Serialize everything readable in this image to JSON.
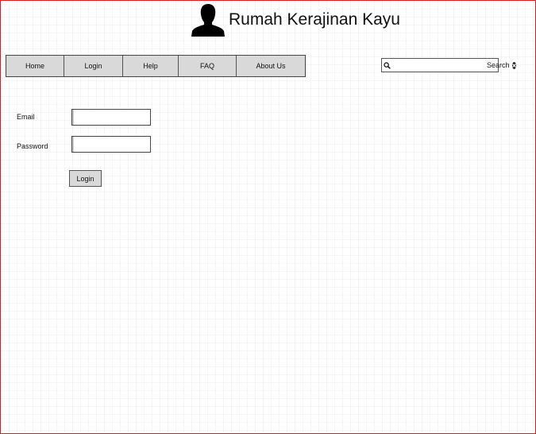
{
  "header": {
    "title": "Rumah Kerajinan Kayu",
    "icon": "user-silhouette-icon"
  },
  "nav": {
    "items": [
      {
        "label": "Home"
      },
      {
        "label": "Login"
      },
      {
        "label": "Help"
      },
      {
        "label": "FAQ"
      },
      {
        "label": "About Us"
      }
    ]
  },
  "search": {
    "label": "Search",
    "value": "",
    "icon": "search-icon",
    "clear_icon": "clear-icon"
  },
  "form": {
    "email_label": "Email",
    "email_value": "",
    "password_label": "Password",
    "password_value": "",
    "submit_label": "Login"
  },
  "colors": {
    "frame_border": "#d4202a",
    "button_fill": "#d9d9d9"
  }
}
